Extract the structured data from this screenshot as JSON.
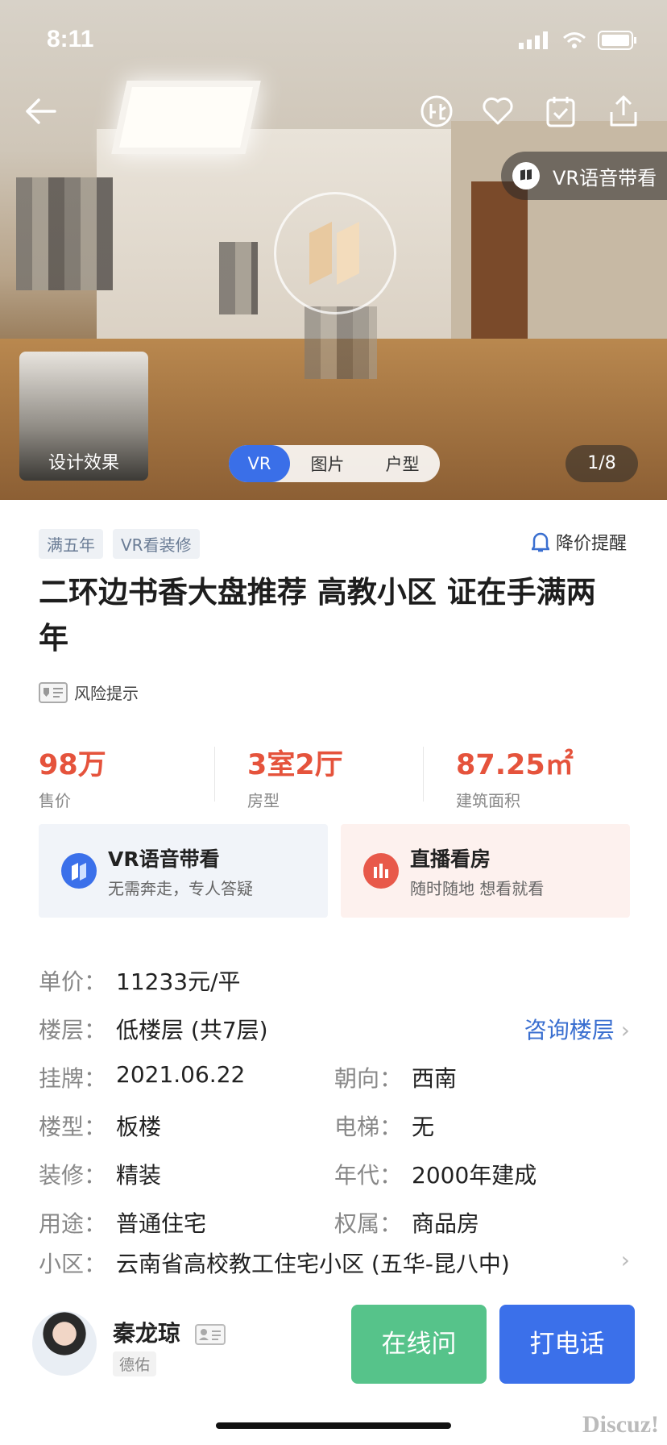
{
  "status": {
    "time": "8:11"
  },
  "hero": {
    "vr_pill_label": "VR语音带看",
    "design_label": "设计效果",
    "segments": [
      "VR",
      "图片",
      "户型"
    ],
    "counter": "1/8"
  },
  "listing": {
    "tags": [
      "满五年",
      "VR看装修"
    ],
    "alert": "降价提醒",
    "title": "二环边书香大盘推荐 高教小区 证在手满两年",
    "risk": "风险提示",
    "stats": [
      {
        "value": "98万",
        "label": "售价"
      },
      {
        "value": "3室2厅",
        "label": "房型"
      },
      {
        "value": "87.25㎡",
        "label": "建筑面积"
      }
    ],
    "cards": {
      "vr": {
        "title": "VR语音带看",
        "sub": "无需奔走，专人答疑"
      },
      "live": {
        "title": "直播看房",
        "sub": "随时随地 想看就看"
      }
    },
    "details": {
      "unit_price": {
        "k": "单价：",
        "v": "11233元/平"
      },
      "floor": {
        "k": "楼层：",
        "v": "低楼层 (共7层)",
        "link": "咨询楼层"
      },
      "listed": {
        "k": "挂牌：",
        "v": "2021.06.22"
      },
      "orientation": {
        "k": "朝向：",
        "v": "西南"
      },
      "building_type": {
        "k": "楼型：",
        "v": "板楼"
      },
      "elevator": {
        "k": "电梯：",
        "v": "无"
      },
      "decoration": {
        "k": "装修：",
        "v": "精装"
      },
      "era": {
        "k": "年代：",
        "v": "2000年建成"
      },
      "usage": {
        "k": "用途：",
        "v": "普通住宅"
      },
      "ownership": {
        "k": "权属：",
        "v": "商品房"
      },
      "community": {
        "k": "小区：",
        "v": "云南省高校教工住宅小区 (五华-昆八中)"
      }
    }
  },
  "agent": {
    "name": "秦龙琼",
    "company": "德佑",
    "chat_label": "在线问",
    "call_label": "打电话"
  },
  "watermark": "Discuz!",
  "colors": {
    "accent": "#3b70ea",
    "price": "#e5533c",
    "chat": "#56c38a"
  }
}
